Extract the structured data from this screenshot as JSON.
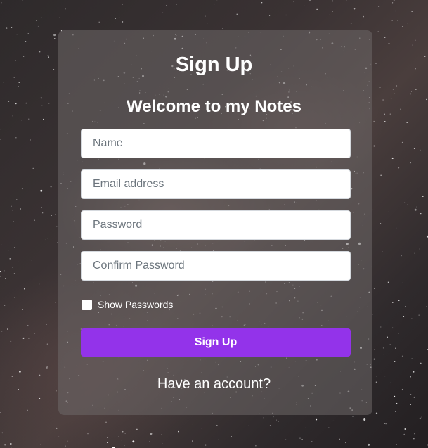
{
  "form": {
    "title": "Sign Up",
    "subtitle": "Welcome to my Notes",
    "fields": [
      {
        "placeholder": "Name",
        "value": ""
      },
      {
        "placeholder": "Email address",
        "value": ""
      },
      {
        "placeholder": "Password",
        "value": ""
      },
      {
        "placeholder": "Confirm Password",
        "value": ""
      }
    ],
    "show_passwords_label": "Show Passwords",
    "show_passwords_checked": false,
    "submit_label": "Sign Up",
    "account_link": "Have an account?"
  },
  "colors": {
    "accent": "#9333ea",
    "card": "rgba(110,104,104,0.55)",
    "text": "#ffffff"
  }
}
